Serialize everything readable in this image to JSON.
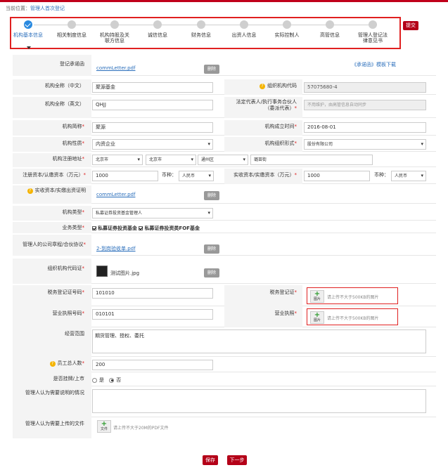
{
  "breadcrumb": {
    "prefix": "当前位置：",
    "current": "管理人首次登记"
  },
  "steps": [
    {
      "label": "机构基本信息",
      "active": true
    },
    {
      "label": "相关制度信息",
      "active": false
    },
    {
      "label": "机构持股及关联方信息",
      "active": false
    },
    {
      "label": "诚信信息",
      "active": false
    },
    {
      "label": "财务信息",
      "active": false
    },
    {
      "label": "出资人信息",
      "active": false
    },
    {
      "label": "实际控制人",
      "active": false
    },
    {
      "label": "高管信息",
      "active": false
    },
    {
      "label": "管理人登记法律意见书",
      "active": false
    }
  ],
  "submit_label": "提交",
  "form": {
    "promise_label": "登记承诺函",
    "promise_file": "commLetter.pdf",
    "delete_label": "删除",
    "promise_template_link": "《承诺函》模板下载",
    "name_cn_label": "机构全称（中文）",
    "name_cn_value": "聚源基金",
    "org_code_label": "组织机构代码",
    "org_code_value": "57075680-4",
    "name_en_label": "机构全称（英文）",
    "name_en_value": "QHJJ",
    "legal_rep_label": "法定代表人/执行事务合伙人（委派代表）",
    "legal_rep_placeholder": "不用维护，由高管信息自动同步",
    "short_name_label": "机构简称",
    "short_name_value": "聚源",
    "founded_label": "机构成立时间",
    "founded_value": "2016-08-01",
    "nature_label": "机构性质",
    "nature_value": "内资企业",
    "org_form_label": "机构组织形式",
    "org_form_value": "股份有限公司",
    "reg_addr_label": "机构注册地址",
    "reg_addr_province": "北京市",
    "reg_addr_city": "北京市",
    "reg_addr_district": "通州区",
    "reg_addr_detail": "璐苗街",
    "reg_capital_label": "注册资本/认缴资本（万元）",
    "reg_capital_value": "1000",
    "currency_label": "币种：",
    "currency_value": "人民币",
    "paid_capital_label": "实收资本/实缴资本（万元）",
    "paid_capital_value": "1000",
    "paid_currency_value": "人民币",
    "paid_proof_label": "实收资本/实缴出资证明",
    "paid_proof_file": "commLetter.pdf",
    "org_type_label": "机构类型",
    "org_type_value": "私募证券投资基金管理人",
    "biz_type_label": "业务类型",
    "biz_type_1": "私募证券投资基金",
    "biz_type_2": "私募证券投资类FOF基金",
    "articles_label": "管理人的公司章程/合伙协议",
    "articles_file": "2-到岗验收单.pdf",
    "org_code_cert_label": "组织机构代码证",
    "org_code_cert_file": "测试图片.jpg",
    "tax_no_label": "税务登记证号码",
    "tax_no_value": "101010",
    "tax_cert_label": "税务登记证",
    "upload_label": "图片",
    "upload_hint": "请上传不大于500KB的图片",
    "license_no_label": "营业执照号码",
    "license_no_value": "010101",
    "license_label": "营业执照",
    "scope_label": "经营范围",
    "scope_value": "期货管理、授权、委托",
    "staff_label": "员工总人数",
    "staff_value": "200",
    "listed_label": "是否挂牌/上市",
    "listed_yes": "是",
    "listed_no": "否",
    "explain_label": "管理人认为需要说明的情况",
    "upload_files_label": "管理人认为需要上传的文件",
    "upload_file_btn": "文件",
    "upload_file_hint": "请上传不大于20M的PDF文件"
  },
  "save_label": "保存",
  "next_label": "下一步"
}
